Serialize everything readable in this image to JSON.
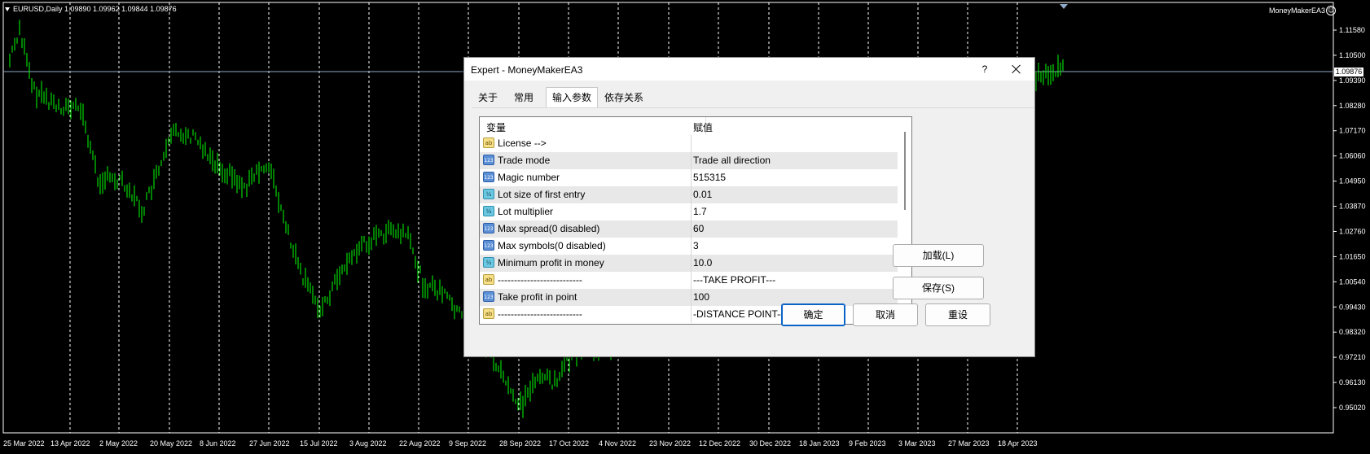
{
  "chart": {
    "symbol_line": "EURUSD,Daily  1.09890 1.09962 1.09844 1.09876",
    "ea_name": "MoneyMakerEA3",
    "current_price": "1.09876",
    "price_labels": [
      "1.11580",
      "1.10500",
      "1.09390",
      "1.08280",
      "1.07170",
      "1.06060",
      "1.04950",
      "1.03870",
      "1.02760",
      "1.01650",
      "1.00540",
      "0.99430",
      "0.98320",
      "0.97210",
      "0.96130",
      "0.95020"
    ],
    "date_labels": [
      "25 Mar 2022",
      "13 Apr 2022",
      "2 May 2022",
      "20 May 2022",
      "8 Jun 2022",
      "27 Jun 2022",
      "15 Jul 2022",
      "3 Aug 2022",
      "22 Aug 2022",
      "9 Sep 2022",
      "28 Sep 2022",
      "17 Oct 2022",
      "4 Nov 2022",
      "23 Nov 2022",
      "12 Dec 2022",
      "30 Dec 2022",
      "18 Jan 2023",
      "9 Feb 2023",
      "3 Mar 2023",
      "27 Mar 2023",
      "18 Apr 2023"
    ],
    "colors": {
      "background": "#000000",
      "candles": "#00ff00",
      "grid": "#ffffff",
      "price_line": "#8fa9c8"
    }
  },
  "dialog": {
    "title": "Expert - MoneyMakerEA3",
    "help": "?",
    "tabs": [
      "关于",
      "常用",
      "输入参数",
      "依存关系"
    ],
    "active_tab": "输入参数",
    "columns": [
      "变量",
      "赋值"
    ],
    "rows": [
      {
        "icon": "ab",
        "variable": "License -->",
        "value": ""
      },
      {
        "icon": "123",
        "variable": "Trade mode",
        "value": "Trade all direction"
      },
      {
        "icon": "123",
        "variable": "Magic number",
        "value": "515315"
      },
      {
        "icon": "half",
        "variable": "Lot size of first entry",
        "value": "0.01"
      },
      {
        "icon": "half",
        "variable": "Lot multiplier",
        "value": "1.7"
      },
      {
        "icon": "123",
        "variable": "Max spread(0 disabled)",
        "value": "60"
      },
      {
        "icon": "123",
        "variable": "Max symbols(0 disabled)",
        "value": "3"
      },
      {
        "icon": "half",
        "variable": "Minimum profit in money",
        "value": "10.0"
      },
      {
        "icon": "ab",
        "variable": "--------------------------",
        "value": "---TAKE PROFIT---"
      },
      {
        "icon": "123",
        "variable": "Take profit in point",
        "value": "100"
      },
      {
        "icon": "ab",
        "variable": "--------------------------",
        "value": "-DISTANCE POINT--"
      }
    ],
    "buttons": {
      "load": "加载(L)",
      "save": "保存(S)",
      "ok": "确定",
      "cancel": "取消",
      "reset": "重设"
    }
  }
}
